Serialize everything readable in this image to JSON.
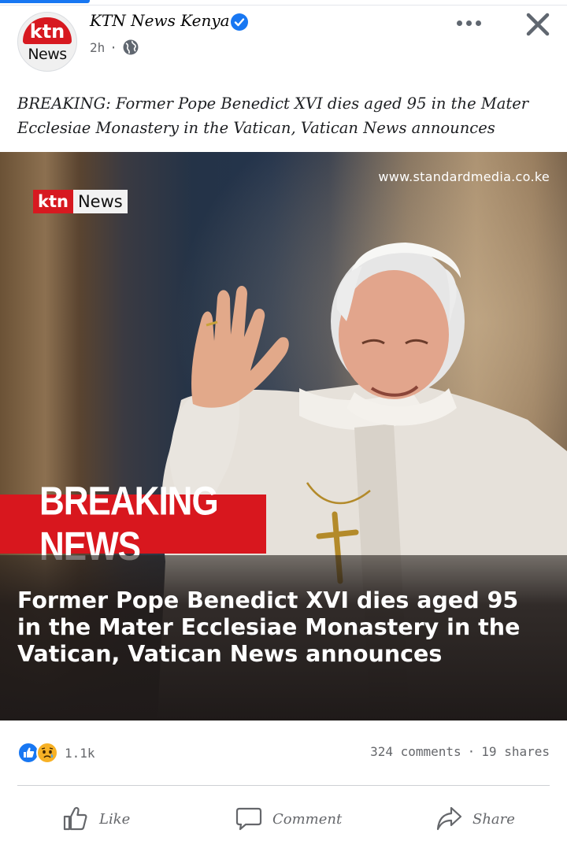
{
  "post": {
    "page_name": "KTN News Kenya",
    "time": "2h",
    "separator": "·",
    "avatar": {
      "top": "ktn",
      "bottom": "News"
    },
    "text": "BREAKING: Former Pope Benedict XVI dies aged 95 in the Mater Ecclesiae Monastery in the Vatican, Vatican News announces"
  },
  "photo": {
    "watermark": "www.standardmedia.co.ke",
    "badge": {
      "red": "ktn",
      "white": "News"
    },
    "band": "BREAKING NEWS",
    "headline": "Former Pope Benedict XVI dies aged 95 in the Mater Ecclesiae Monastery in the Vatican, Vatican News announces"
  },
  "stats": {
    "reaction_count": "1.1k",
    "comments": "324 comments",
    "dot": "·",
    "shares": "19 shares"
  },
  "actions": {
    "like": "Like",
    "comment": "Comment",
    "share": "Share"
  },
  "colors": {
    "brand_blue": "#1877f2",
    "ktn_red": "#d71920",
    "band_red": "#d8171e"
  },
  "icons": [
    "verified-badge-icon",
    "globe-icon",
    "more-icon",
    "close-icon",
    "like-reaction-icon",
    "sad-reaction-icon",
    "thumbs-up-icon",
    "comment-icon",
    "share-icon"
  ]
}
